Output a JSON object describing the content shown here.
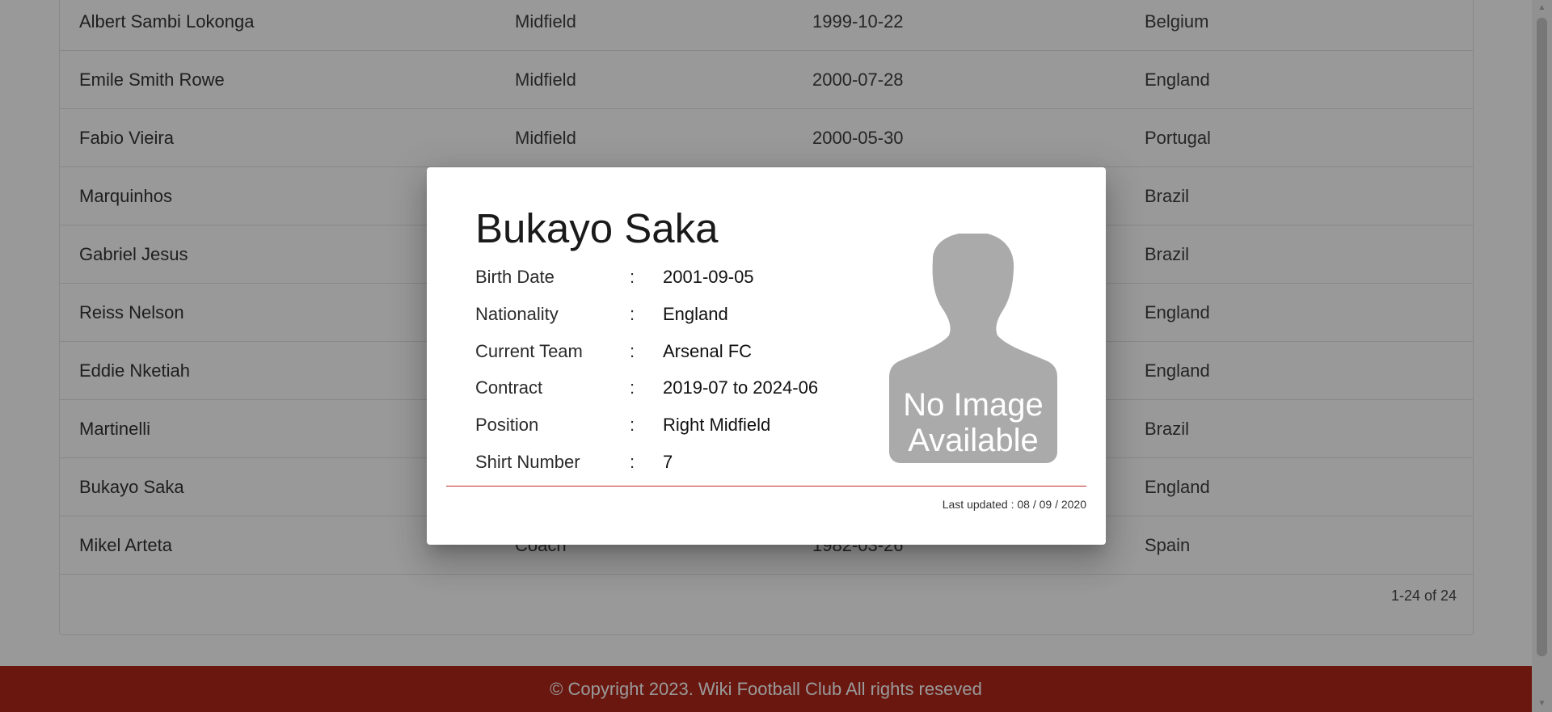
{
  "players": [
    {
      "name": "Albert Sambi Lokonga",
      "position": "Midfield",
      "birth_date": "1999-10-22",
      "nationality": "Belgium"
    },
    {
      "name": "Emile Smith Rowe",
      "position": "Midfield",
      "birth_date": "2000-07-28",
      "nationality": "England"
    },
    {
      "name": "Fabio Vieira",
      "position": "Midfield",
      "birth_date": "2000-05-30",
      "nationality": "Portugal"
    },
    {
      "name": "Marquinhos",
      "position": "",
      "birth_date": "",
      "nationality": "Brazil"
    },
    {
      "name": "Gabriel Jesus",
      "position": "",
      "birth_date": "",
      "nationality": "Brazil"
    },
    {
      "name": "Reiss Nelson",
      "position": "",
      "birth_date": "",
      "nationality": "England"
    },
    {
      "name": "Eddie Nketiah",
      "position": "",
      "birth_date": "",
      "nationality": "England"
    },
    {
      "name": "Martinelli",
      "position": "",
      "birth_date": "",
      "nationality": "Brazil"
    },
    {
      "name": "Bukayo Saka",
      "position": "",
      "birth_date": "",
      "nationality": "England"
    },
    {
      "name": "Mikel Arteta",
      "position": "Coach",
      "birth_date": "1982-03-26",
      "nationality": "Spain"
    }
  ],
  "pagination": {
    "range_text": "1-24 of 24"
  },
  "footer": {
    "copyright": "© Copyright 2023. Wiki Football Club All rights reseved"
  },
  "dialog": {
    "title": "Bukayo Saka",
    "fields": [
      {
        "label": "Birth Date",
        "value": "2001-09-05"
      },
      {
        "label": "Nationality",
        "value": "England"
      },
      {
        "label": "Current Team",
        "value": "Arsenal FC"
      },
      {
        "label": "Contract",
        "value": "2019-07 to 2024-06"
      },
      {
        "label": "Position",
        "value": "Right Midfield"
      },
      {
        "label": "Shirt Number",
        "value": "7"
      }
    ],
    "colon": ":",
    "image_placeholder": "No Image Available",
    "image_placeholder_line1": "No Image",
    "image_placeholder_line2": "Available",
    "last_updated": "Last updated : 08 / 09 / 2020"
  },
  "colors": {
    "footer": "#a80f00",
    "divider": "#c62828",
    "placeholder": "#aaaaaa"
  },
  "icons": {
    "placeholder": "person-silhouette-icon",
    "scroll_up": "triangle-up-icon",
    "scroll_down": "triangle-down-icon"
  }
}
